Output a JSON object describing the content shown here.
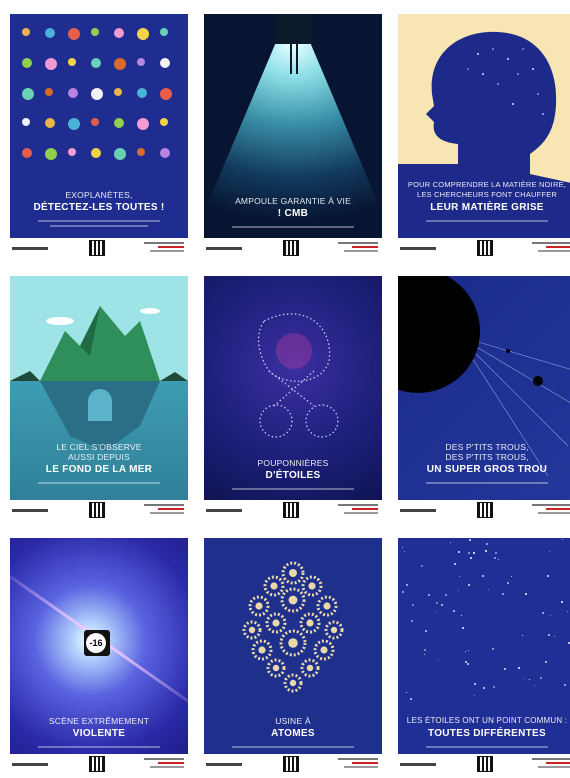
{
  "posters": [
    {
      "line1": "EXOPLANÈTES,",
      "line2": "DÉTECTEZ-LES TOUTES !"
    },
    {
      "line1": "AMPOULE GARANTIE À VIE",
      "line2": "! CMB"
    },
    {
      "line1": "POUR COMPRENDRE LA MATIÈRE NOIRE,",
      "line1b": "LES CHERCHEURS FONT CHAUFFER",
      "line2": "LEUR MATIÈRE GRISE"
    },
    {
      "line1": "LE CIEL S'OBSERVE",
      "line1b": "AUSSI DEPUIS",
      "line2": "LE FOND DE LA MER"
    },
    {
      "line1": "POUPONNIÈRES",
      "line2": "D'ÉTOILES"
    },
    {
      "line1": "DES P'TITS TROUS,",
      "line1b": "DES P'TITS TROUS,",
      "line2": "UN SUPER GROS TROU"
    },
    {
      "line1": "SCÈNE EXTRÊMEMENT",
      "line2": "VIOLENTE",
      "badge": "-16"
    },
    {
      "line1": "USINE À",
      "line2": "ATOMES"
    },
    {
      "line1": "LES ÉTOILES ONT UN POINT COMMUN :",
      "line2": "TOUTES DIFFÉRENTES"
    }
  ],
  "colors": {
    "navy": "#1f2f8c",
    "cream": "#f7e6b4",
    "teal": "#8fd9e0",
    "sea": "#3f9fb3",
    "gear": "#e9d9a8"
  }
}
